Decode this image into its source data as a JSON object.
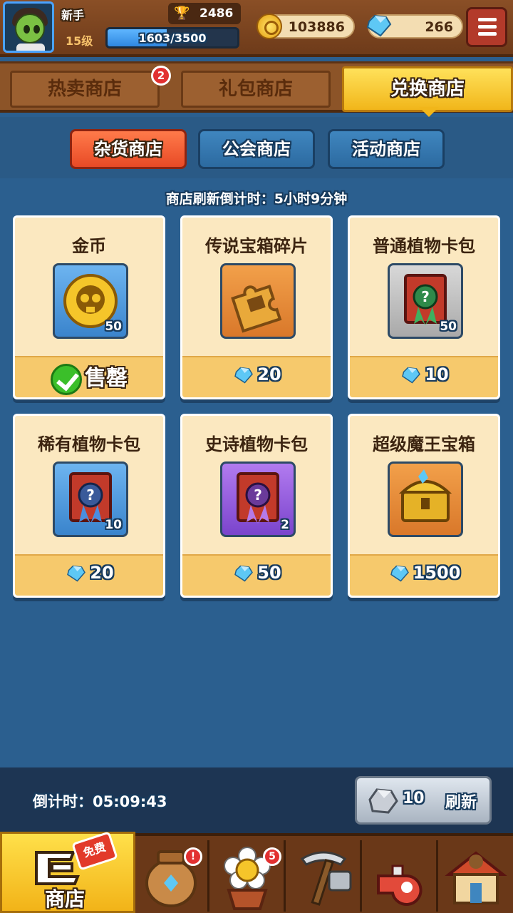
{
  "player": {
    "name": "新手",
    "level": "15级",
    "xp": "1603/3500",
    "xp_fraction": 0.458,
    "trophies": "2486"
  },
  "currency": {
    "coins": "103886",
    "gems": "266"
  },
  "shop_tabs": [
    {
      "label": "热卖商店",
      "badge": "2"
    },
    {
      "label": "礼包商店"
    },
    {
      "label": "兑换商店"
    }
  ],
  "sub_tabs": [
    {
      "label": "杂货商店"
    },
    {
      "label": "公会商店"
    },
    {
      "label": "活动商店"
    }
  ],
  "refresh_text": "商店刷新倒计时：5小时9分钟",
  "items": [
    {
      "title": "金币",
      "qty": "50",
      "status": "售罄",
      "icon": "skull-coin-icon"
    },
    {
      "title": "传说宝箱碎片",
      "price": "20",
      "icon": "puzzle-chest-icon"
    },
    {
      "title": "普通植物卡包",
      "qty": "50",
      "price": "10",
      "icon": "card-pack-green-icon"
    },
    {
      "title": "稀有植物卡包",
      "qty": "10",
      "price": "20",
      "icon": "card-pack-blue-icon"
    },
    {
      "title": "史诗植物卡包",
      "qty": "2",
      "price": "50",
      "icon": "card-pack-purple-icon"
    },
    {
      "title": "超级魔王宝箱",
      "price": "1500",
      "icon": "golden-chest-icon"
    }
  ],
  "countdown": "倒计时：05:09:43",
  "refresh_button": {
    "cost": "10",
    "label": "刷新"
  },
  "nav": {
    "shop_label": "商店",
    "free_tag": "免费",
    "items": [
      {
        "icon": "shop-icon"
      },
      {
        "icon": "vase-icon",
        "badge": "!"
      },
      {
        "icon": "flower-pot-icon",
        "badge": "5"
      },
      {
        "icon": "pickaxe-icon"
      },
      {
        "icon": "whistle-icon"
      },
      {
        "icon": "house-icon"
      }
    ]
  },
  "colors": {
    "accent_yellow": "#f1b61a",
    "subtab_active": "#e84a26",
    "gem_blue": "#5ec8f5"
  }
}
